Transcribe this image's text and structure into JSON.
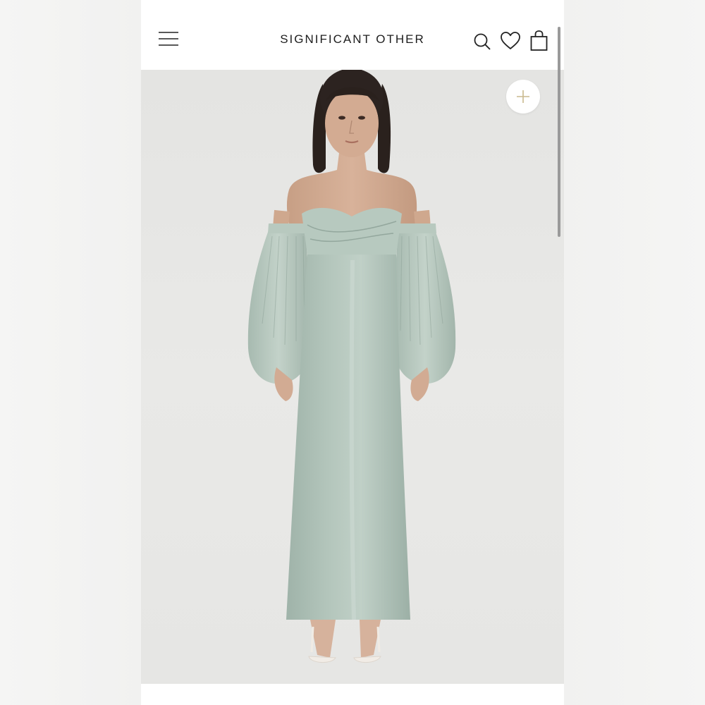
{
  "header": {
    "brand": "SIGNIFICANT OTHER",
    "menu_icon": "hamburger-menu-icon",
    "search_icon": "search-icon",
    "wishlist_icon": "heart-icon",
    "bag_icon": "shopping-bag-icon"
  },
  "product": {
    "image_subject": "model wearing sage off-shoulder satin gown with balloon sleeves",
    "add_icon": "plus-icon"
  },
  "colors": {
    "background": "#ffffff",
    "image_background": "#e7e7e5",
    "brand_text": "#1d1d1d",
    "dress": "#a9bcb2",
    "plus_accent": "#c9b98e"
  }
}
